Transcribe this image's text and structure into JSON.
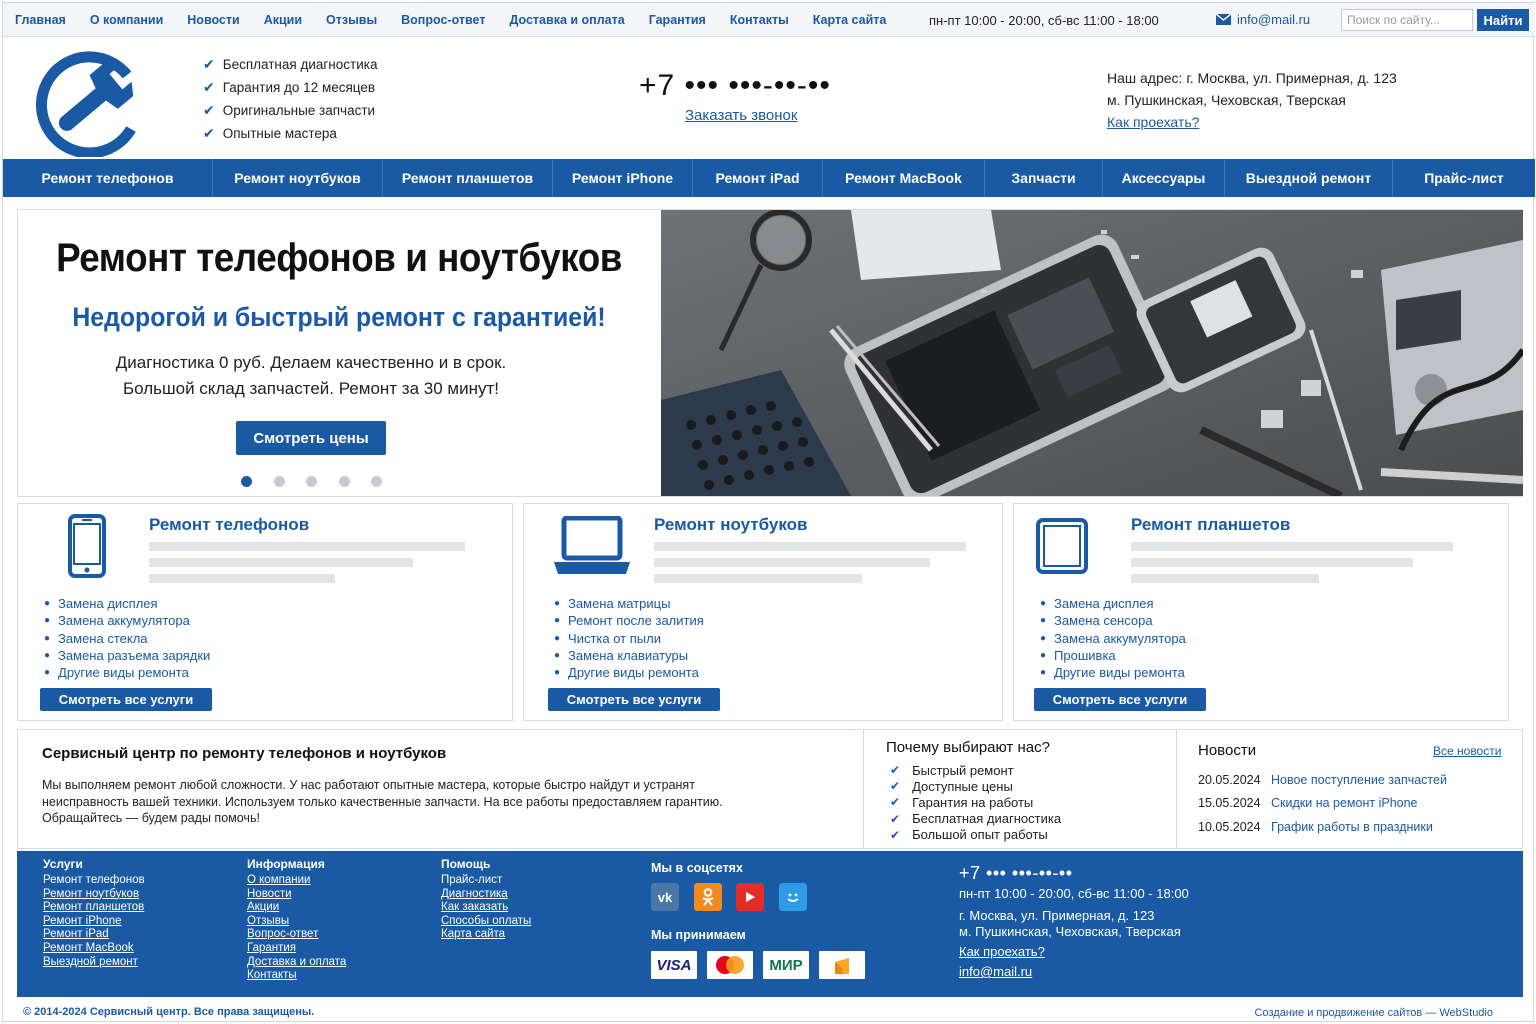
{
  "topnav": [
    "Главная",
    "О компании",
    "Новости",
    "Акции",
    "Отзывы",
    "Вопрос-ответ",
    "Доставка и оплата",
    "Гарантия",
    "Контакты",
    "Карта сайта"
  ],
  "topbar": {
    "hours": "пн-пт 10:00 - 20:00, сб-вс 11:00 - 18:00",
    "email": "info@mail.ru",
    "search_placeholder": "Поиск по сайту...",
    "search_button": "Найти"
  },
  "header": {
    "benefits": [
      "Бесплатная диагностика",
      "Гарантия до 12 месяцев",
      "Оригинальные запчасти",
      "Опытные мастера"
    ],
    "phone": "+7 ••• •••-••-••",
    "callback": "Заказать звонок",
    "address_line1": "Наш адрес: г. Москва, ул. Примерная, д. 123",
    "address_line2": "м. Пушкинская, Чеховская, Тверская",
    "route_link": "Как проехать?"
  },
  "mainnav": [
    "Ремонт телефонов",
    "Ремонт ноутбуков",
    "Ремонт планшетов",
    "Ремонт iPhone",
    "Ремонт iPad",
    "Ремонт MacBook",
    "Запчасти",
    "Аксессуары",
    "Выездной ремонт",
    "Прайс-лист"
  ],
  "hero": {
    "title": "Ремонт телефонов и ноутбуков",
    "subtitle": "Недорогой и быстрый ремонт с гарантией!",
    "line1": "Диагностика 0 руб. Делаем качественно и в срок.",
    "line2": "Большой склад запчастей. Ремонт за 30 минут!",
    "button": "Смотреть цены",
    "slides": 5,
    "active_slide": 1
  },
  "cards": [
    {
      "title": "Ремонт телефонов",
      "icon": "smartphone-icon",
      "items": [
        "Замена дисплея",
        "Замена аккумулятора",
        "Замена стекла",
        "Замена разъема зарядки",
        "Другие виды ремонта"
      ],
      "button": "Смотреть все услуги"
    },
    {
      "title": "Ремонт ноутбуков",
      "icon": "laptop-icon",
      "items": [
        "Замена матрицы",
        "Ремонт после залития",
        "Чистка от пыли",
        "Замена клавиатуры",
        "Другие виды ремонта"
      ],
      "button": "Смотреть все услуги"
    },
    {
      "title": "Ремонт планшетов",
      "icon": "tablet-icon",
      "items": [
        "Замена дисплея",
        "Замена сенсора",
        "Замена аккумулятора",
        "Прошивка",
        "Другие виды ремонта"
      ],
      "button": "Смотреть все услуги"
    }
  ],
  "about": {
    "title": "Сервисный центр по ремонту телефонов и ноутбуков",
    "text1": "Мы выполняем ремонт любой сложности. У нас работают опытные мастера, которые быстро найдут и устранят",
    "text2": "неисправность вашей техники. Используем только качественные запчасти. На все работы предоставляем гарантию.",
    "text3": "Обращайтесь — будем рады помочь!"
  },
  "why": {
    "title": "Почему выбирают нас?",
    "items": [
      "Быстрый ремонт",
      "Доступные цены",
      "Гарантия на работы",
      "Бесплатная диагностика",
      "Большой опыт работы"
    ]
  },
  "news": {
    "title": "Новости",
    "all_link": "Все новости",
    "items": [
      {
        "date": "20.05.2024",
        "title": "Новое поступление запчастей"
      },
      {
        "date": "15.05.2024",
        "title": "Скидки на ремонт iPhone"
      },
      {
        "date": "10.05.2024",
        "title": "График работы в праздники"
      }
    ]
  },
  "footer": {
    "services_title": "Услуги",
    "services": [
      "Ремонт телефонов",
      "Ремонт ноутбуков",
      "Ремонт планшетов",
      "Ремонт iPhone",
      "Ремонт iPad",
      "Ремонт MacBook",
      "Выездной ремонт"
    ],
    "info_title": "Информация",
    "info": [
      "О компании",
      "Новости",
      "Акции",
      "Отзывы",
      "Вопрос-ответ",
      "Гарантия",
      "Доставка и оплата",
      "Контакты"
    ],
    "help_title": "Помощь",
    "help": [
      "Прайс-лист",
      "Диагностика",
      "Как заказать",
      "Способы оплаты",
      "Карта сайта"
    ],
    "social_title": "Мы в соцсетях",
    "social": [
      {
        "icon": "vk-icon",
        "color": "#4a76a8"
      },
      {
        "icon": "odnoklassniki-icon",
        "color": "#f28a1e"
      },
      {
        "icon": "youtube-icon",
        "color": "#e52d27"
      },
      {
        "icon": "smile-icon",
        "color": "#2f9be8"
      }
    ],
    "pay_title": "Мы принимаем",
    "pay": [
      {
        "label": "VISA",
        "icon": "visa-icon"
      },
      {
        "label": "",
        "icon": "mastercard-icon"
      },
      {
        "label": "МИР",
        "icon": "mir-icon"
      },
      {
        "label": "",
        "icon": "yandex-money-icon"
      }
    ],
    "phone": "+7 ••• •••-••-••",
    "hours": "пн-пт 10:00 - 20:00, сб-вс 11:00 - 18:00",
    "addr1": "г. Москва, ул. Примерная, д. 123",
    "addr2": "м. Пушкинская, Чеховская, Тверская",
    "route": "Как проехать?",
    "email": "info@mail.ru"
  },
  "copyright": "© 2014-2024 Сервисный центр. Все права защищены.",
  "studio": "Создание и продвижение сайтов — WebStudio",
  "colors": {
    "brand": "#1a5aa5",
    "border": "#d5dbe3",
    "bar_placeholder": "#e2e4e7"
  }
}
